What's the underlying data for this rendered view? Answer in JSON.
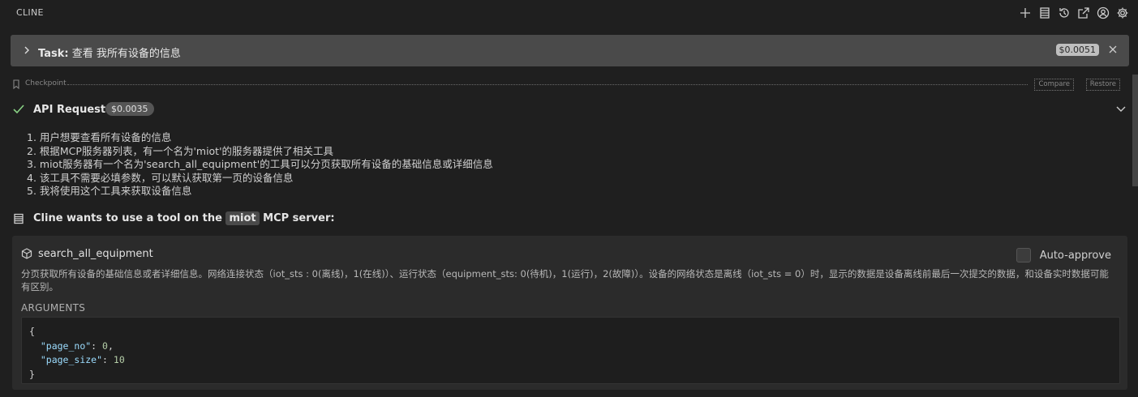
{
  "header": {
    "title": "CLINE"
  },
  "toolbar_icons": [
    "plus-icon",
    "server-icon",
    "history-icon",
    "popout-icon",
    "account-icon",
    "gear-icon"
  ],
  "task": {
    "label": "Task:",
    "text": "查看 我所有设备的信息",
    "cost": "$0.0051"
  },
  "checkpoint": {
    "label": "Checkpoint",
    "compare": "Compare",
    "restore": "Restore"
  },
  "api_request": {
    "label": "API Request",
    "cost": "$0.0035"
  },
  "reasoning": [
    "1. 用户想要查看所有设备的信息",
    "2. 根据MCP服务器列表，有一个名为'miot'的服务器提供了相关工具",
    "3. miot服务器有一个名为'search_all_equipment'的工具可以分页获取所有设备的基础信息或详细信息",
    "4. 该工具不需要必填参数，可以默认获取第一页的设备信息",
    "5. 我将使用这个工具来获取设备信息"
  ],
  "tool_request": {
    "prefix": "Cline wants to use a tool on the",
    "server": "miot",
    "suffix": "MCP server:"
  },
  "tool": {
    "name": "search_all_equipment",
    "auto_approve": "Auto-approve",
    "description": "分页获取所有设备的基础信息或者详细信息。网络连接状态（iot_sts : 0(离线)，1(在线)）、运行状态（equipment_sts: 0(待机)，1(运行)，2(故障)）。设备的网络状态是离线（iot_sts = 0）时，显示的数据是设备离线前最后一次提交的数据，和设备实时数据可能有区别。",
    "arguments_label": "ARGUMENTS",
    "arguments": {
      "open": "{",
      "k1": "\"page_no\"",
      "v1": "0",
      "k2": "\"page_size\"",
      "v2": "10",
      "close": "}"
    }
  },
  "colors": {
    "accent_check": "#89d185",
    "task_bg": "#4a4a4a",
    "json_key": "#9cdcfe",
    "json_number": "#b5cea8"
  }
}
